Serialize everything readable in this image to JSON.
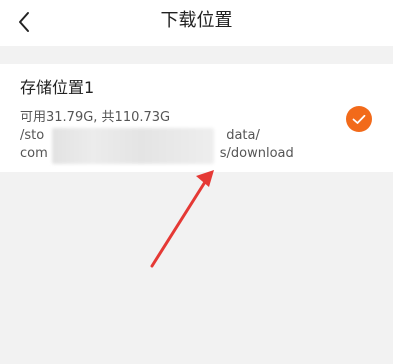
{
  "header": {
    "title": "下载位置",
    "back_icon": "chevron-left-icon"
  },
  "storage": {
    "name": "存储位置1",
    "capacity": "可用31.79G, 共110.73G",
    "path_line1_start": "/sto",
    "path_line1_end": "data/",
    "path_line2_start": "com",
    "path_line2_end": "s/download",
    "selected": true,
    "check_icon": "check-circle-icon"
  },
  "annotation": {
    "arrow_icon": "red-arrow-icon"
  },
  "colors": {
    "accent": "#f26a1a",
    "annotation": "#e53935",
    "background": "#f2f2f2"
  }
}
